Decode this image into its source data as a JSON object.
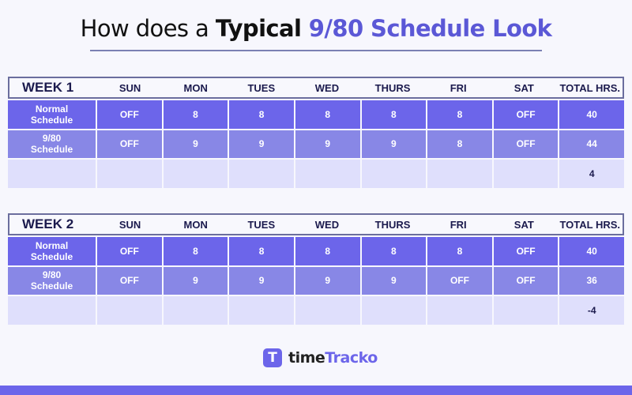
{
  "title": {
    "part1": "How does a ",
    "part2": "Typical",
    "part3": " 9/80 Schedule Look"
  },
  "columns": [
    "SUN",
    "MON",
    "TUES",
    "WED",
    "THURS",
    "FRI",
    "SAT",
    "TOTAL HRS."
  ],
  "weeks": [
    {
      "label": "WEEK 1",
      "rows": [
        {
          "label": "Normal Schedule",
          "values": [
            "OFF",
            "8",
            "8",
            "8",
            "8",
            "8",
            "OFF",
            "40"
          ]
        },
        {
          "label": "9/80 Schedule",
          "values": [
            "OFF",
            "9",
            "9",
            "9",
            "9",
            "8",
            "OFF",
            "44"
          ]
        },
        {
          "label": "",
          "values": [
            "",
            "",
            "",
            "",
            "",
            "",
            "",
            "4"
          ]
        }
      ]
    },
    {
      "label": "WEEK 2",
      "rows": [
        {
          "label": "Normal Schedule",
          "values": [
            "OFF",
            "8",
            "8",
            "8",
            "8",
            "8",
            "OFF",
            "40"
          ]
        },
        {
          "label": "9/80 Schedule",
          "values": [
            "OFF",
            "9",
            "9",
            "9",
            "9",
            "OFF",
            "OFF",
            "36"
          ]
        },
        {
          "label": "",
          "values": [
            "",
            "",
            "",
            "",
            "",
            "",
            "",
            "-4"
          ]
        }
      ]
    }
  ],
  "logo": {
    "icon_letter": "T",
    "text_part1": "time",
    "text_part2": "Tracko"
  },
  "colors": {
    "accent": "#6c65ea",
    "row_normal": "#6c65ea",
    "row_980": "#8887e6",
    "row_diff": "#dfdffc",
    "heading_text": "#1b1a4d"
  }
}
